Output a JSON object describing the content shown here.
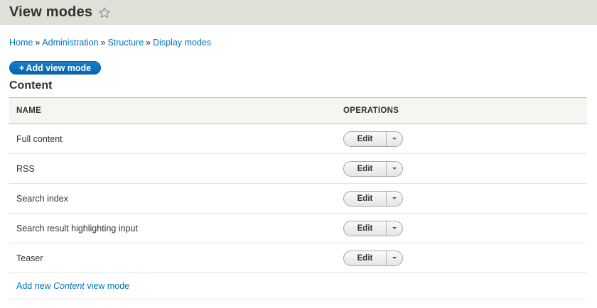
{
  "page": {
    "title": "View modes"
  },
  "breadcrumb": [
    {
      "label": "Home"
    },
    {
      "label": "Administration"
    },
    {
      "label": "Structure"
    },
    {
      "label": "Display modes"
    }
  ],
  "breadcrumb_separator": "»",
  "actions": {
    "add_view_mode": "Add view mode",
    "add_icon": "+"
  },
  "section": {
    "title": "Content"
  },
  "table": {
    "headers": {
      "name": "NAME",
      "operations": "OPERATIONS"
    },
    "rows": [
      {
        "name": "Full content",
        "op": "Edit"
      },
      {
        "name": "RSS",
        "op": "Edit"
      },
      {
        "name": "Search index",
        "op": "Edit"
      },
      {
        "name": "Search result highlighting input",
        "op": "Edit"
      },
      {
        "name": "Teaser",
        "op": "Edit"
      }
    ],
    "footer_link": {
      "prefix": "Add new ",
      "entity": "Content",
      "suffix": " view mode"
    }
  },
  "colors": {
    "link": "#0074bd",
    "primary_button": "#0066b3",
    "header_bg": "#e0e0d8"
  },
  "icons": {
    "title_star": "star-outline-icon",
    "dropdown": "caret-down-icon"
  }
}
